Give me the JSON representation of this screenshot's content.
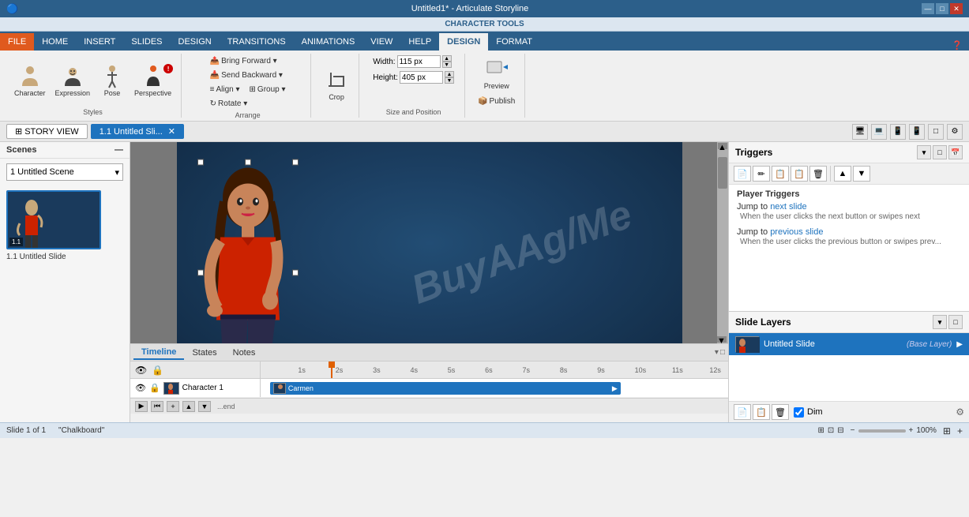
{
  "titlebar": {
    "title": "Untitled1* - Articulate Storyline",
    "controls": [
      "—",
      "□",
      "✕"
    ]
  },
  "char_tools_bar": {
    "label": "CHARACTER TOOLS"
  },
  "ribbon_tabs": [
    {
      "id": "file",
      "label": "FILE",
      "type": "file"
    },
    {
      "id": "home",
      "label": "HOME"
    },
    {
      "id": "insert",
      "label": "INSERT"
    },
    {
      "id": "slides",
      "label": "SLIDES"
    },
    {
      "id": "design",
      "label": "DESIGN"
    },
    {
      "id": "transitions",
      "label": "TRANSITIONS"
    },
    {
      "id": "animations",
      "label": "ANIMATIONS"
    },
    {
      "id": "view",
      "label": "VIEW"
    },
    {
      "id": "help",
      "label": "HELP"
    },
    {
      "id": "design2",
      "label": "DESIGN",
      "type": "design-active"
    },
    {
      "id": "format",
      "label": "FORMAT"
    }
  ],
  "ribbon": {
    "styles_group": {
      "label": "Styles",
      "buttons": [
        {
          "id": "character",
          "label": "Character"
        },
        {
          "id": "expression",
          "label": "Expression"
        },
        {
          "id": "pose",
          "label": "Pose"
        },
        {
          "id": "perspective",
          "label": "Perspective"
        }
      ]
    },
    "arrange_group": {
      "label": "Arrange",
      "buttons": [
        {
          "id": "bring-forward",
          "label": "Bring Forward ▾"
        },
        {
          "id": "send-backward",
          "label": "Send Backward ▾"
        },
        {
          "id": "align",
          "label": "Align ▾"
        },
        {
          "id": "group",
          "label": "Group ▾"
        },
        {
          "id": "rotate",
          "label": "Rotate ▾"
        }
      ]
    },
    "crop_group": {
      "label": "",
      "crop_label": "Crop"
    },
    "size_group": {
      "label": "Size and Position",
      "width_label": "Width:",
      "width_value": "115 px",
      "height_label": "Height:",
      "height_value": "405 px"
    },
    "publish_group": {
      "label": "",
      "preview_label": "Preview",
      "publish_label": "Publish"
    }
  },
  "navbar": {
    "story_view": "STORY VIEW",
    "slide_tab": "1.1 Untitled Sli...",
    "icons": [
      "□",
      "□",
      "□",
      "□",
      "□",
      "⚙"
    ]
  },
  "scenes": {
    "header": "Scenes",
    "scene_name": "1 Untitled Scene",
    "slides": [
      {
        "id": "1.1",
        "label": "1.1 Untitled Slide"
      }
    ]
  },
  "canvas": {
    "watermark": "BuyAAg/Me"
  },
  "timeline": {
    "tabs": [
      "Timeline",
      "States",
      "Notes"
    ],
    "active_tab": "Timeline",
    "tracks": [
      {
        "id": "char1",
        "label": "Character 1",
        "character": "Carmen",
        "bar_left": "5%",
        "bar_width": "60%"
      }
    ]
  },
  "triggers": {
    "header": "Triggers",
    "section": "Player Triggers",
    "items": [
      {
        "id": "t1",
        "main_text": "Jump to ",
        "link": "next slide",
        "desc": "When the user clicks the next button or swipes next"
      },
      {
        "id": "t2",
        "main_text": "Jump to ",
        "link": "previous slide",
        "desc": "When the user clicks the previous button or swipes prev..."
      }
    ],
    "toolbar_icons": [
      "📄",
      "✏️",
      "📋",
      "📋",
      "🗑",
      "▲",
      "▼"
    ]
  },
  "layers": {
    "header": "Slide Layers",
    "items": [
      {
        "id": "base",
        "name": "Untitled Slide",
        "badge": "(Base Layer)",
        "active": true
      }
    ],
    "dim_label": "Dim",
    "dim_checked": true
  },
  "statusbar": {
    "slide_info": "Slide 1 of 1",
    "theme": "\"Chalkboard\"",
    "zoom": "100%"
  }
}
